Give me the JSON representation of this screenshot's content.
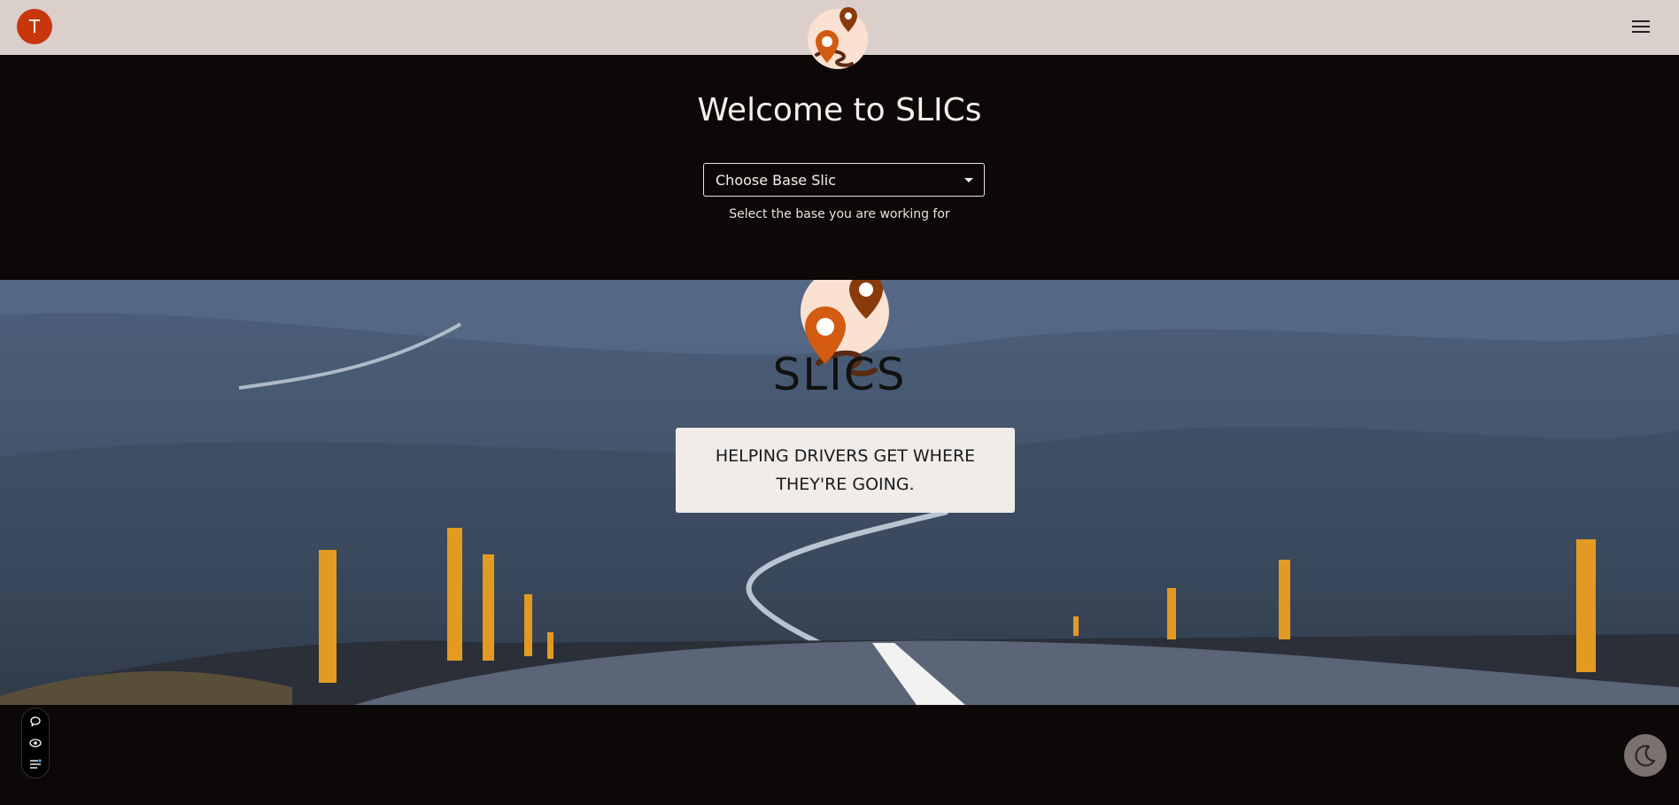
{
  "header": {
    "avatar_initial": "T",
    "logo_icon": "slics-map-pin-logo",
    "menu_icon": "hamburger-menu-icon"
  },
  "main": {
    "welcome_title": "Welcome to SLICs",
    "base_select": {
      "selected_label": "Choose Base Slic"
    },
    "helper_text": "Select the base you are working for"
  },
  "hero": {
    "brand_name": "SLICS",
    "tagline": "HELPING DRIVERS GET WHERE THEY'RE GOING."
  },
  "floating_tools": {
    "icons": [
      "chat-bubble-icon",
      "eye-icon",
      "settings-list-icon"
    ]
  },
  "theme_toggle": {
    "icon": "moon-icon"
  },
  "colors": {
    "accent": "#c8360c",
    "pin_orange": "#d35b12",
    "pin_brown": "#8a3b0c",
    "topbar_bg": "#dbcfcc",
    "page_bg": "#0b0807"
  }
}
